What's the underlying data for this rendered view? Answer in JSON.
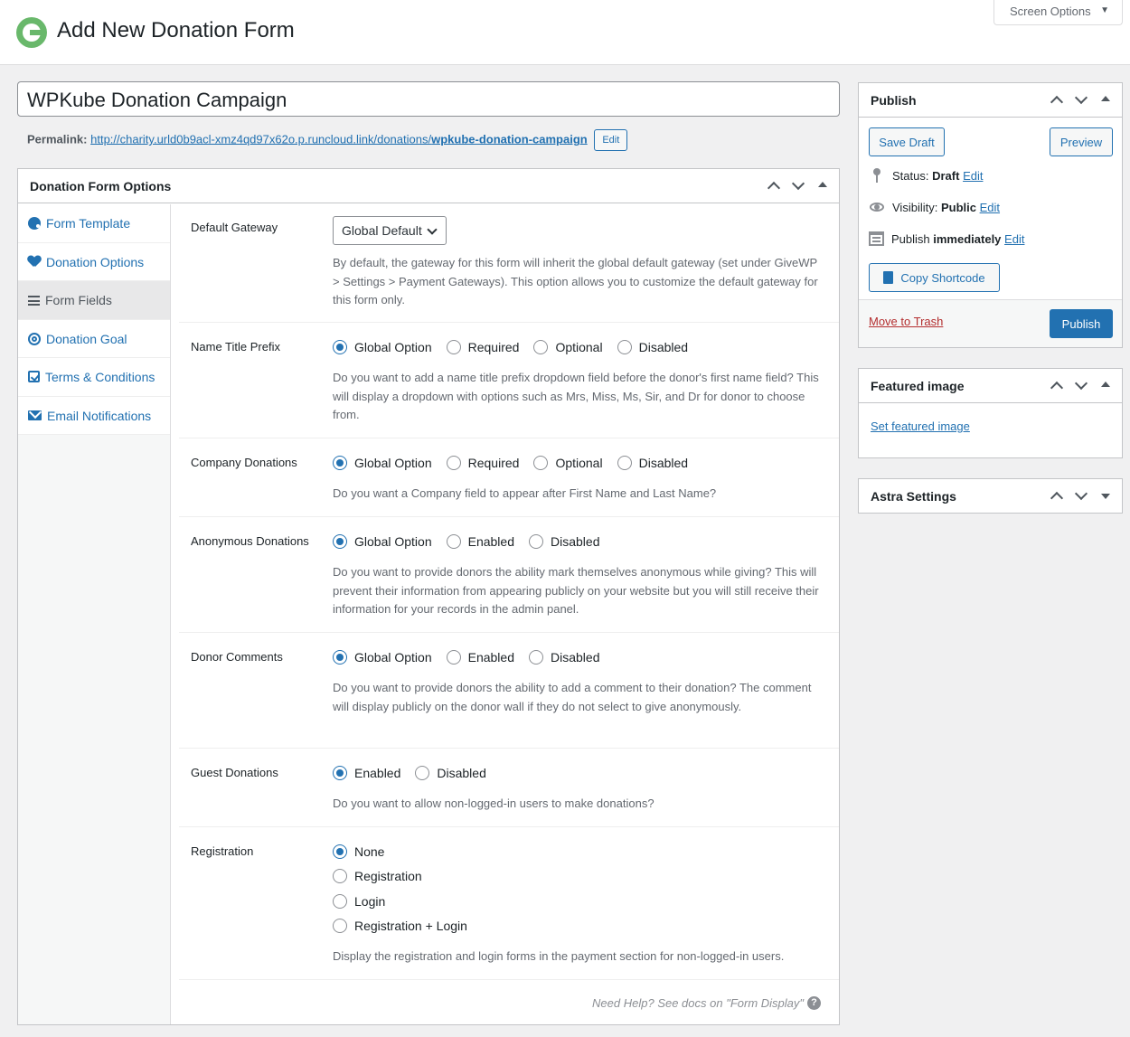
{
  "header": {
    "page_title": "Add New Donation Form",
    "screen_options": "Screen Options"
  },
  "post": {
    "title": "WPKube Donation Campaign",
    "permalink_label": "Permalink:",
    "permalink_base": "http://charity.urld0b9acl-xmz4qd97x62o.p.runcloud.link/donations/",
    "permalink_slug": "wpkube-donation-campaign",
    "edit_label": "Edit"
  },
  "options_box": {
    "title": "Donation Form Options",
    "tabs": [
      {
        "label": "Form Template",
        "icon": "palette-icon"
      },
      {
        "label": "Donation Options",
        "icon": "heart-icon"
      },
      {
        "label": "Form Fields",
        "icon": "list-icon"
      },
      {
        "label": "Donation Goal",
        "icon": "target-icon"
      },
      {
        "label": "Terms & Conditions",
        "icon": "checkbox-icon"
      },
      {
        "label": "Email Notifications",
        "icon": "mail-icon"
      }
    ],
    "active_tab": "Form Fields",
    "fields": {
      "gateway": {
        "label": "Default Gateway",
        "value": "Global Default",
        "desc": "By default, the gateway for this form will inherit the global default gateway (set under GiveWP > Settings > Payment Gateways). This option allows you to customize the default gateway for this form only."
      },
      "name_title": {
        "label": "Name Title Prefix",
        "options": [
          "Global Option",
          "Required",
          "Optional",
          "Disabled"
        ],
        "selected": "Global Option",
        "desc": "Do you want to add a name title prefix dropdown field before the donor's first name field? This will display a dropdown with options such as Mrs, Miss, Ms, Sir, and Dr for donor to choose from."
      },
      "company": {
        "label": "Company Donations",
        "options": [
          "Global Option",
          "Required",
          "Optional",
          "Disabled"
        ],
        "selected": "Global Option",
        "desc": "Do you want a Company field to appear after First Name and Last Name?"
      },
      "anonymous": {
        "label": "Anonymous Donations",
        "options": [
          "Global Option",
          "Enabled",
          "Disabled"
        ],
        "selected": "Global Option",
        "desc": "Do you want to provide donors the ability mark themselves anonymous while giving? This will prevent their information from appearing publicly on your website but you will still receive their information for your records in the admin panel."
      },
      "comments": {
        "label": "Donor Comments",
        "options": [
          "Global Option",
          "Enabled",
          "Disabled"
        ],
        "selected": "Global Option",
        "desc": "Do you want to provide donors the ability to add a comment to their donation? The comment will display publicly on the donor wall if they do not select to give anonymously."
      },
      "guest": {
        "label": "Guest Donations",
        "options": [
          "Enabled",
          "Disabled"
        ],
        "selected": "Enabled",
        "desc": "Do you want to allow non-logged-in users to make donations?"
      },
      "registration": {
        "label": "Registration",
        "options": [
          "None",
          "Registration",
          "Login",
          "Registration + Login"
        ],
        "selected": "None",
        "desc": "Display the registration and login forms in the payment section for non-logged-in users."
      }
    },
    "help_text": "Need Help? See docs on \"Form Display\"",
    "help_icon": "?"
  },
  "publish_box": {
    "title": "Publish",
    "save_draft": "Save Draft",
    "preview": "Preview",
    "status_label": "Status:",
    "status_value": "Draft",
    "visibility_label": "Visibility:",
    "visibility_value": "Public",
    "publish_label": "Publish",
    "publish_value": "immediately",
    "edit_link": "Edit",
    "copy_shortcode": "Copy Shortcode",
    "move_to_trash": "Move to Trash",
    "publish_button": "Publish"
  },
  "featured_box": {
    "title": "Featured image",
    "link": "Set featured image"
  },
  "astra_box": {
    "title": "Astra Settings"
  },
  "colors": {
    "accent": "#2271b1",
    "logo": "#69b86b",
    "trash": "#b32d2e"
  }
}
